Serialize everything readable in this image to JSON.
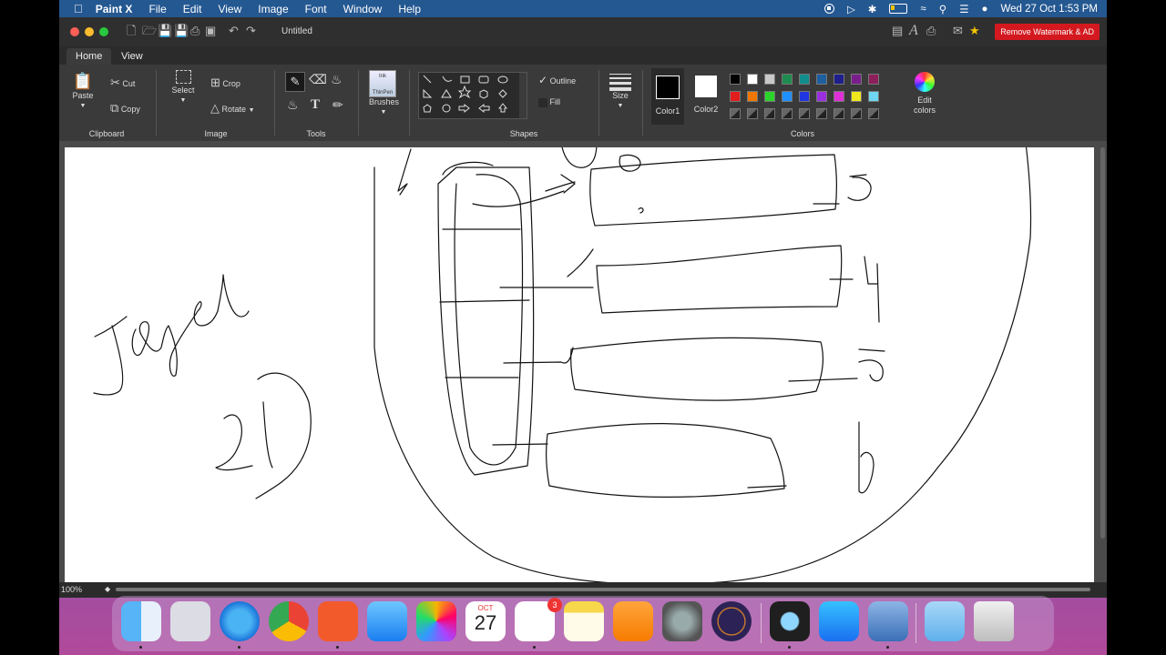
{
  "menubar": {
    "app_name": "Paint X",
    "items": [
      "File",
      "Edit",
      "View",
      "Image",
      "Font",
      "Window",
      "Help"
    ],
    "clock": "Wed 27 Oct  1:53 PM"
  },
  "window": {
    "title": "Untitled",
    "remove_watermark": "Remove Watermark & AD"
  },
  "tabs": [
    "Home",
    "View"
  ],
  "ribbon": {
    "clipboard": {
      "label": "Clipboard",
      "paste": "Paste",
      "cut": "Cut",
      "copy": "Copy"
    },
    "image": {
      "label": "Image",
      "select": "Select",
      "crop": "Crop",
      "rotate": "Rotate"
    },
    "tools": {
      "label": "Tools"
    },
    "brushes": {
      "label": "Brushes",
      "thumb": "ThinPen",
      "thumb_small": "Ink"
    },
    "shapes": {
      "label": "Shapes",
      "outline": "Outline",
      "fill": "Fill"
    },
    "size": {
      "label": "Size"
    },
    "colors": {
      "label": "Colors",
      "color1": "Color1",
      "color2": "Color2",
      "edit": "Edit colors",
      "color1_value": "#000000",
      "color2_value": "#ffffff",
      "palette_row1": [
        "#000000",
        "#ffffff",
        "#c8c8c8",
        "#1e8c4e",
        "#128c8c",
        "#1e5fa0",
        "#1e1e8c",
        "#7a1e8c",
        "#8c1e5a"
      ],
      "palette_row2": [
        "#e11d1d",
        "#f07800",
        "#2bd42b",
        "#1e90ff",
        "#2036e0",
        "#9b2fe0",
        "#e02fd9",
        "#f0e81e",
        "#6ed6f0"
      ]
    }
  },
  "status": {
    "zoom": "100%"
  },
  "dock": {
    "calendar_month": "OCT",
    "calendar_day": "27",
    "reminders_badge": "3",
    "apps": [
      "Finder",
      "Launchpad",
      "Safari",
      "Chrome",
      "Brave",
      "Mail",
      "Photos",
      "Calendar",
      "Reminders",
      "Notes",
      "Pages",
      "System Preferences",
      "Eclipse",
      "QuickTime Player",
      "App Store",
      "Preview",
      "Downloads",
      "Trash"
    ]
  }
}
